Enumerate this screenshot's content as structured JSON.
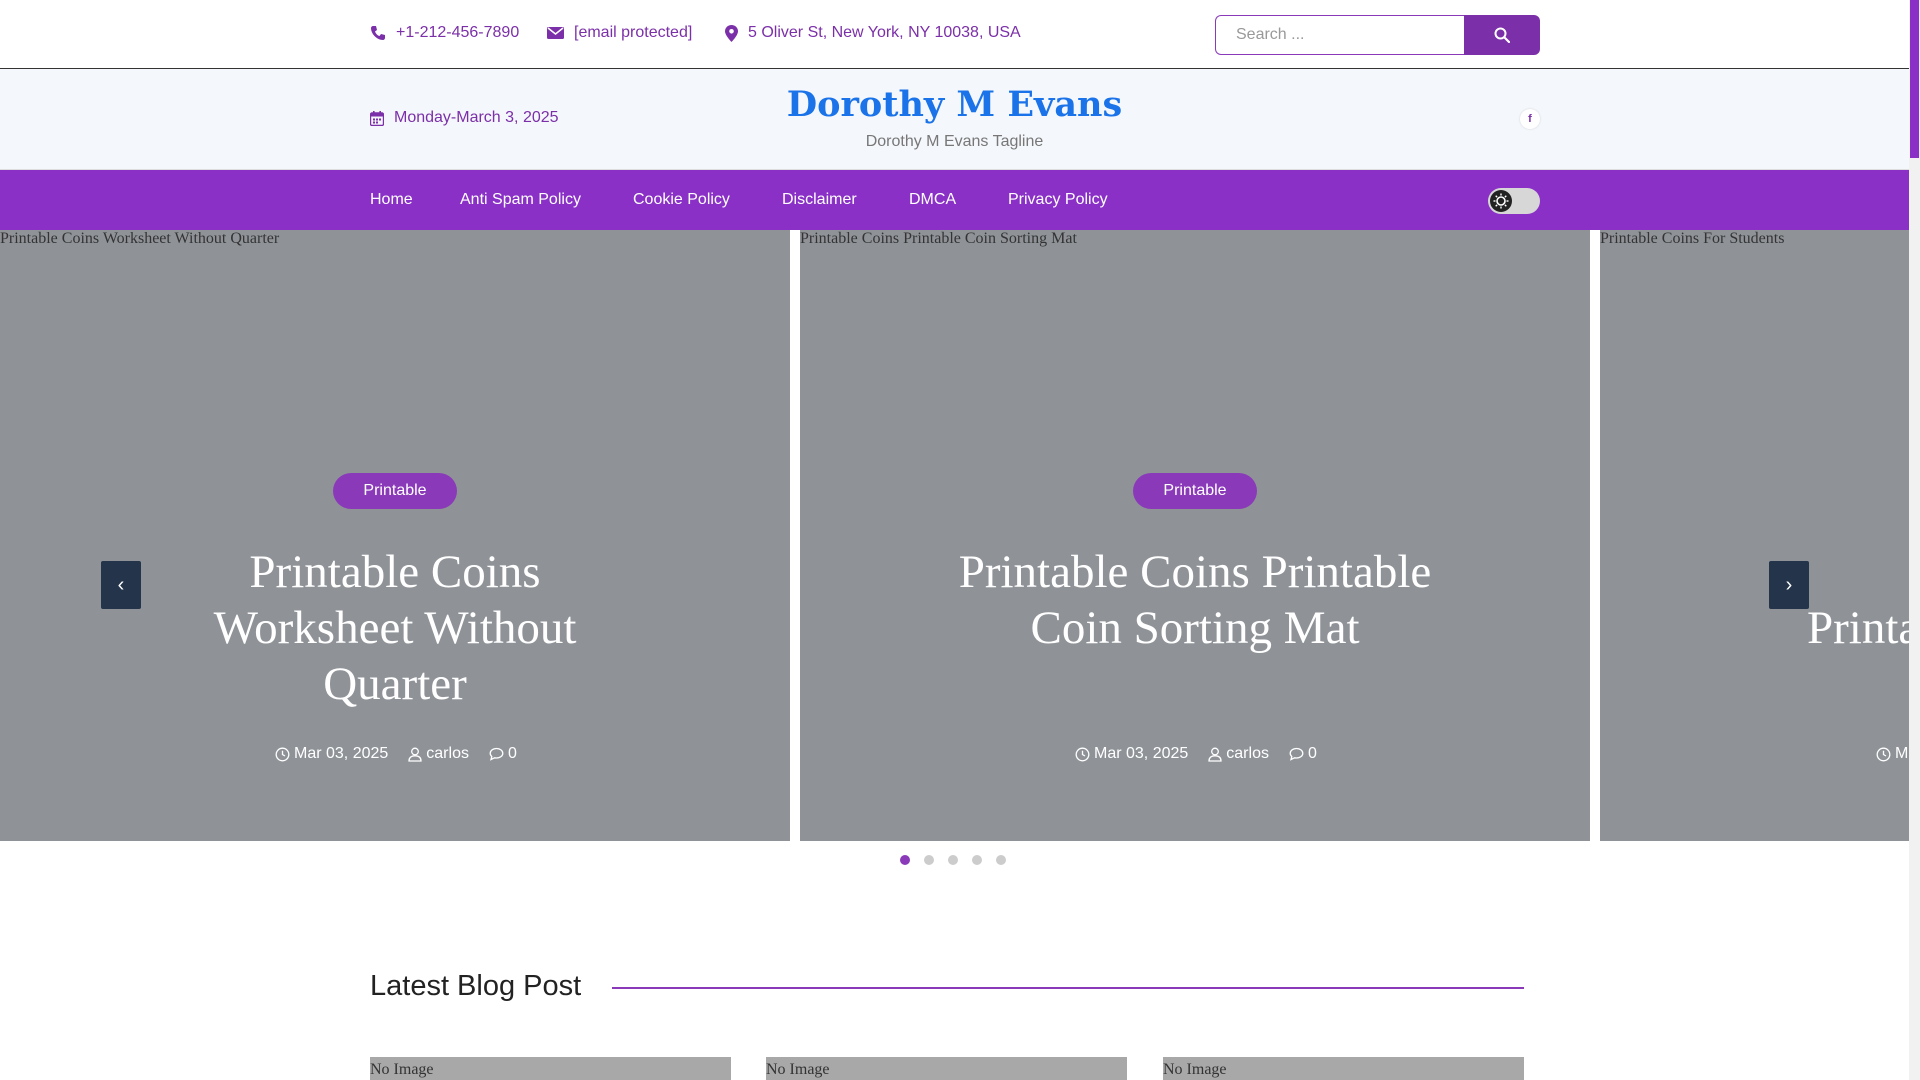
{
  "topbar": {
    "phone": "+1-212-456-7890",
    "email": "[email protected]",
    "address": "5 Oliver St, New York, NY 10038, USA",
    "search_placeholder": "Search ..."
  },
  "header": {
    "date": "Monday-March 3, 2025",
    "site_title": "Dorothy M Evans",
    "tagline": "Dorothy M Evans Tagline",
    "social": "f"
  },
  "nav": {
    "items": [
      "Home",
      "Anti Spam Policy",
      "Cookie Policy",
      "Disclaimer",
      "DMCA",
      "Privacy Policy"
    ]
  },
  "slides": [
    {
      "alt": "Printable Coins Worksheet Without Quarter",
      "category": "Printable",
      "title": "Printable Coins Worksheet Without Quarter",
      "date": "Mar 03, 2025",
      "author": "carlos",
      "comments": "0"
    },
    {
      "alt": "Printable Coins Printable Coin Sorting Mat",
      "category": "Printable",
      "title": "Printable Coins Printable Coin Sorting Mat",
      "date": "Mar 03, 2025",
      "author": "carlos",
      "comments": "0"
    },
    {
      "alt": "Printable Coins For Students",
      "title_partial": "Printa",
      "date_partial": "Ma"
    }
  ],
  "section": {
    "title": "Latest Blog Post",
    "card_alt": "No Image"
  },
  "colors": {
    "accent": "#8a30c6",
    "title_blue": "#1a73e8",
    "slide_overlay": "#8f9398",
    "arrow_bg": "#24344a"
  }
}
